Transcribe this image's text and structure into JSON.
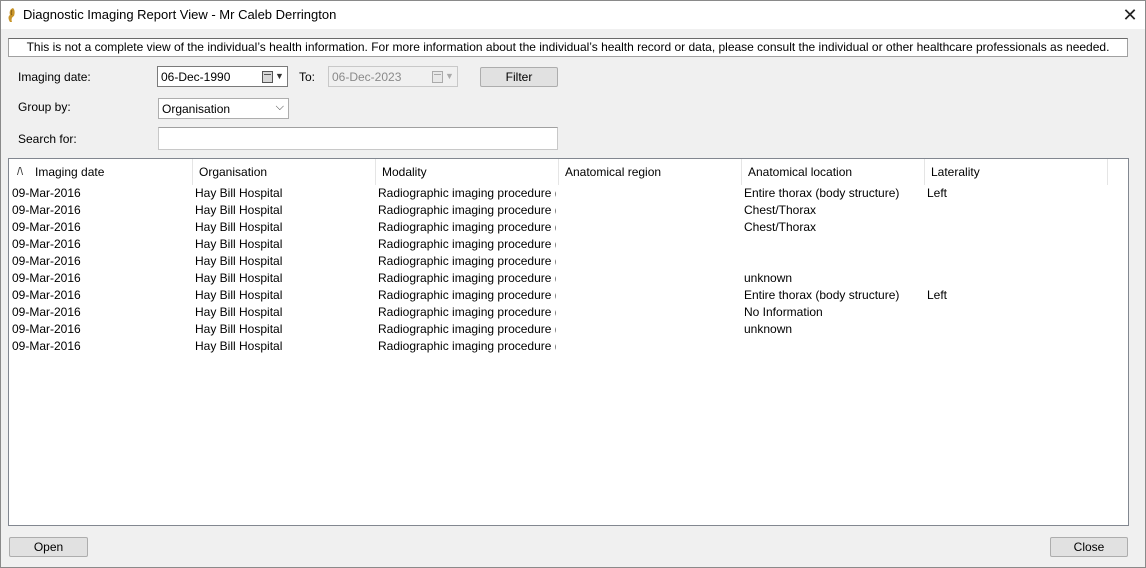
{
  "window": {
    "title": "Diagnostic Imaging Report View - Mr Caleb Derrington",
    "close_glyph": "✕"
  },
  "disclaimer": "This is not a complete view of the individual’s health information. For more information about the individual’s health record or data, please consult the individual or other healthcare professionals as needed.",
  "filters": {
    "imaging_date_label": "Imaging date:",
    "from_date": "06-Dec-1990",
    "to_label": "To:",
    "to_date": "06-Dec-2023",
    "filter_button": "Filter",
    "group_by_label": "Group by:",
    "group_by_value": "Organisation",
    "search_label": "Search for:",
    "search_value": ""
  },
  "table": {
    "sort_glyph": "/\\",
    "columns": [
      "Imaging date",
      "Organisation",
      "Modality",
      "Anatomical region",
      "Anatomical location",
      "Laterality"
    ],
    "rows": [
      [
        "09-Mar-2016",
        "Hay Bill Hospital",
        "Radiographic imaging procedure (pr...",
        "",
        "Entire thorax (body structure)",
        "Left"
      ],
      [
        "09-Mar-2016",
        "Hay Bill Hospital",
        "Radiographic imaging procedure (pr...",
        "",
        "Chest/Thorax",
        ""
      ],
      [
        "09-Mar-2016",
        "Hay Bill Hospital",
        "Radiographic imaging procedure (pr...",
        "",
        "Chest/Thorax",
        ""
      ],
      [
        "09-Mar-2016",
        "Hay Bill Hospital",
        "Radiographic imaging procedure (pr...",
        "",
        "",
        ""
      ],
      [
        "09-Mar-2016",
        "Hay Bill Hospital",
        "Radiographic imaging procedure (pr...",
        "",
        "",
        ""
      ],
      [
        "09-Mar-2016",
        "Hay Bill Hospital",
        "Radiographic imaging procedure (pr...",
        "",
        "unknown",
        ""
      ],
      [
        "09-Mar-2016",
        "Hay Bill Hospital",
        "Radiographic imaging procedure (pr...",
        "",
        "Entire thorax (body structure)",
        "Left"
      ],
      [
        "09-Mar-2016",
        "Hay Bill Hospital",
        "Radiographic imaging procedure (pr...",
        "",
        "No Information",
        ""
      ],
      [
        "09-Mar-2016",
        "Hay Bill Hospital",
        "Radiographic imaging procedure (pr...",
        "",
        "unknown",
        ""
      ],
      [
        "09-Mar-2016",
        "Hay Bill Hospital",
        "Radiographic imaging procedure (pr...",
        "",
        "",
        ""
      ]
    ]
  },
  "footer": {
    "open_button": "Open",
    "close_button": "Close"
  }
}
